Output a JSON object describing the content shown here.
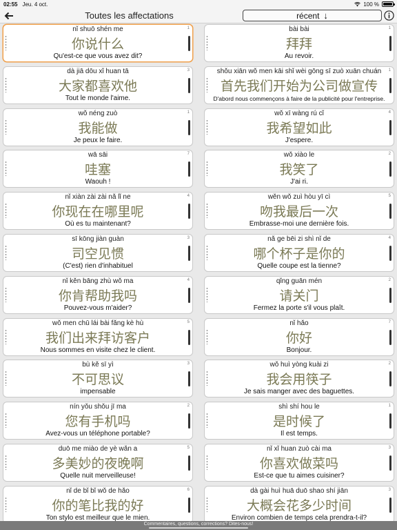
{
  "status": {
    "time": "02:55",
    "date": "Jeu. 4 oct.",
    "battery": "100 %"
  },
  "nav": {
    "title": "Toutes les affectations",
    "sort_label": "récent",
    "sort_arrow": "↓"
  },
  "icons": {
    "back": "arrow-left-icon",
    "info": "info-icon",
    "wifi": "wifi-icon",
    "battery": "battery-icon"
  },
  "colors": {
    "hanzi": "#7b7a56",
    "selected_border": "#f0a04a"
  },
  "cards": [
    {
      "pinyin": "nǐ shuō shén me",
      "hanzi": "你说什么",
      "translation": "Qu'est-ce que vous avez dit?",
      "count": "1",
      "selected": true
    },
    {
      "pinyin": "bài bài",
      "hanzi": "拜拜",
      "translation": "Au revoir.",
      "count": "1"
    },
    {
      "pinyin": "dà jiā dōu xǐ huan tā",
      "hanzi": "大家都喜欢他",
      "translation": "Tout le monde l'aime.",
      "count": "3"
    },
    {
      "pinyin": "shǒu xiān wǒ men kāi shǐ wèi gōng sī zuò xuān chuán",
      "hanzi": "首先我们开始为公司做宣传",
      "translation": "D'abord nous commençons à faire de la publicité pour l'entreprise.",
      "count": "1",
      "small": true
    },
    {
      "pinyin": "wǒ néng zuò",
      "hanzi": "我能做",
      "translation": "Je peux le faire.",
      "count": "1"
    },
    {
      "pinyin": "wǒ xī wàng rú cǐ",
      "hanzi": "我希望如此",
      "translation": "J'espere.",
      "count": "4"
    },
    {
      "pinyin": "wā sāi",
      "hanzi": "哇塞",
      "translation": "Waouh !",
      "count": "7"
    },
    {
      "pinyin": "wǒ xiào le",
      "hanzi": "我笑了",
      "translation": "J'ai ri.",
      "count": "2"
    },
    {
      "pinyin": "nǐ xiàn zài zài nǎ lǐ ne",
      "hanzi": "你现在在哪里呢",
      "translation": "Où es tu maintenant?",
      "count": "4"
    },
    {
      "pinyin": "wěn wǒ zuì hòu yī cì",
      "hanzi": "吻我最后一次",
      "translation": "Embrasse-moi une dernière fois.",
      "count": "5"
    },
    {
      "pinyin": "sī kōng jiàn guàn",
      "hanzi": "司空见惯",
      "translation": "(C'est) rien d'inhabituel",
      "count": "3"
    },
    {
      "pinyin": "nǎ ge bēi zi shì nǐ de",
      "hanzi": "哪个杯子是你的",
      "translation": "Quelle coupe est la tienne?",
      "count": "4"
    },
    {
      "pinyin": "nǐ kěn bāng zhù wǒ ma",
      "hanzi": "你肯帮助我吗",
      "translation": "Pouvez-vous m'aider?",
      "count": "4"
    },
    {
      "pinyin": "qǐng guān mén",
      "hanzi": "请关门",
      "translation": "Fermez la porte s'il vous plaît.",
      "count": "2"
    },
    {
      "pinyin": "wǒ men chū lái bài fǎng kè hù",
      "hanzi": "我们出来拜访客户",
      "translation": "Nous sommes en visite chez le client.",
      "count": "5"
    },
    {
      "pinyin": "nǐ hǎo",
      "hanzi": "你好",
      "translation": "Bonjour.",
      "count": "7"
    },
    {
      "pinyin": "bù kě sī yì",
      "hanzi": "不可思议",
      "translation": "impensable",
      "count": "3"
    },
    {
      "pinyin": "wǒ huì yòng kuài zi",
      "hanzi": "我会用筷子",
      "translation": "Je sais manger avec des baguettes.",
      "count": "2"
    },
    {
      "pinyin": "nín yǒu shǒu jī ma",
      "hanzi": "您有手机吗",
      "translation": "Avez-vous un téléphone portable?",
      "count": "2"
    },
    {
      "pinyin": "shì shí hou le",
      "hanzi": "是时候了",
      "translation": "Il est temps.",
      "count": "1"
    },
    {
      "pinyin": "duō me miào de yè wǎn a",
      "hanzi": "多美妙的夜晚啊",
      "translation": "Quelle nuit merveilleuse!",
      "count": "5"
    },
    {
      "pinyin": "nǐ xǐ huan zuò cài ma",
      "hanzi": "你喜欢做菜吗",
      "translation": "Est-ce que tu aimes cuisiner?",
      "count": "3"
    },
    {
      "pinyin": "nǐ de bǐ bǐ wǒ de hǎo",
      "hanzi": "你的笔比我的好",
      "translation": "Ton stylo est meilleur que le mien.",
      "count": "6"
    },
    {
      "pinyin": "dà gài huì huā duō shao shí jiān",
      "hanzi": "大概会花多少时间",
      "translation": "Environ combien de temps cela prendra-t-il?",
      "count": "3"
    }
  ],
  "footer": {
    "text": "Commentaires, questions, corrections? Dites-nous!"
  }
}
